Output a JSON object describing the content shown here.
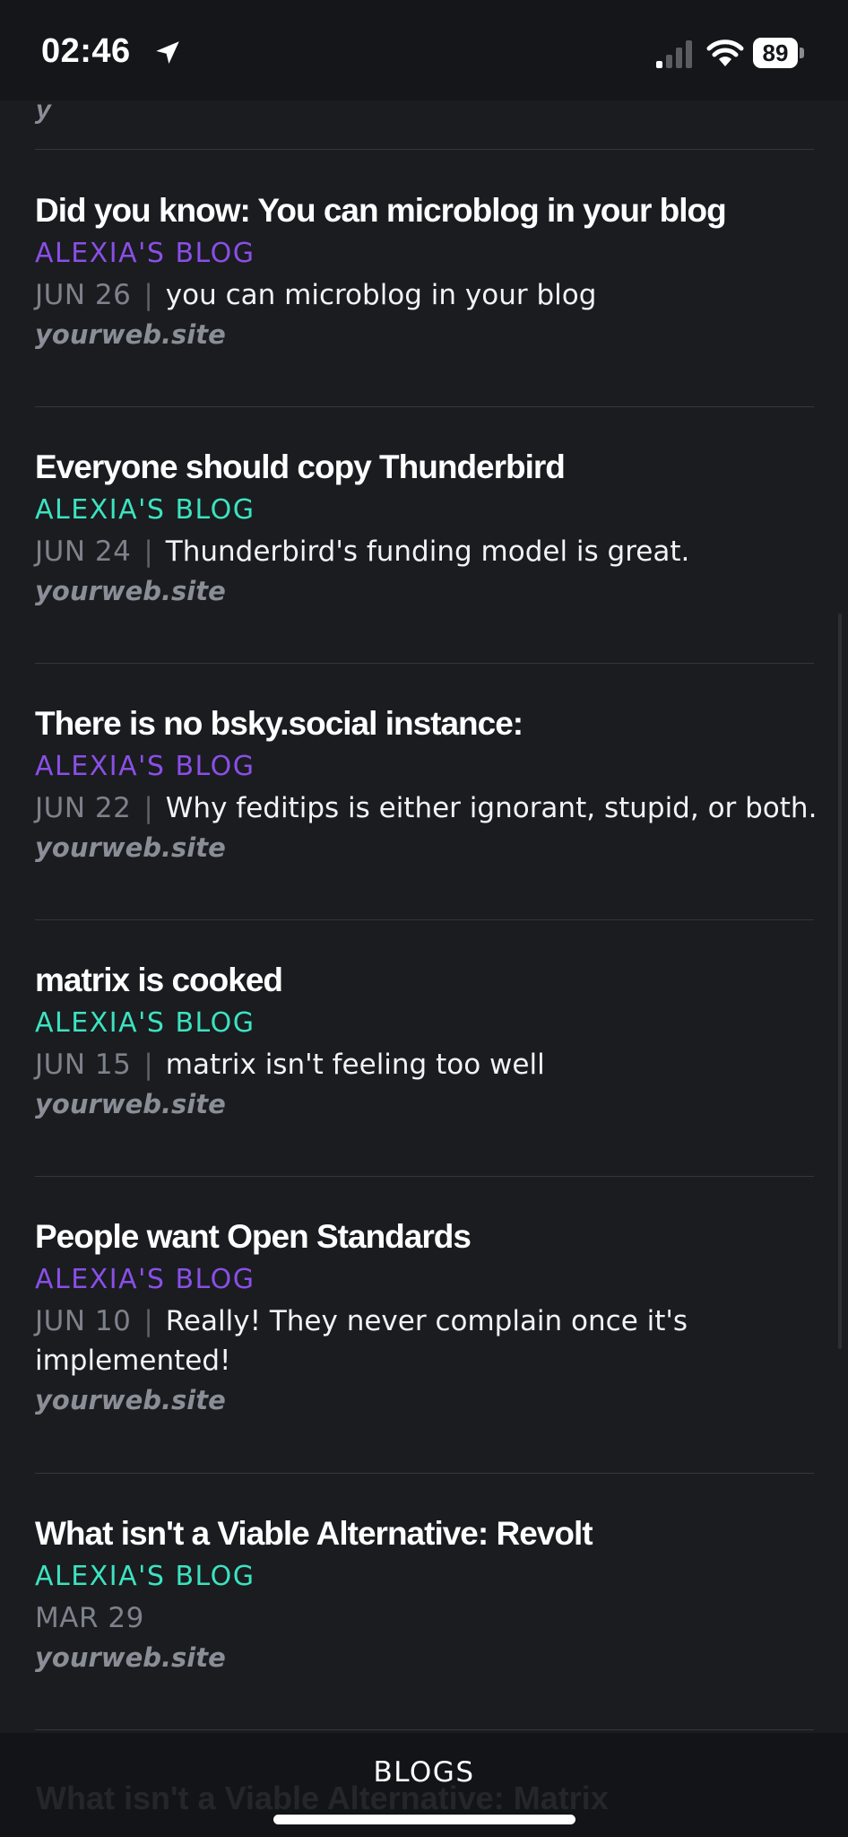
{
  "status_bar": {
    "time": "02:46",
    "battery": "89",
    "icons": [
      "location-arrow-icon",
      "cellular-signal-icon",
      "wifi-icon",
      "battery-icon"
    ]
  },
  "feed": {
    "top_cut_text": "y",
    "posts": [
      {
        "title": "Did you know: You can microblog in your blog",
        "blog": "ALEXIA'S BLOG",
        "blog_color": "#8a4fe6",
        "date": "JUN 26",
        "separator": "|",
        "summary": "you can microblog in your blog",
        "site": "yourweb.site"
      },
      {
        "title": "Everyone should copy Thunderbird",
        "blog": "ALEXIA'S BLOG",
        "blog_color": "#3ce3c0",
        "date": "JUN 24",
        "separator": "|",
        "summary": "Thunderbird's funding model is great.",
        "site": "yourweb.site"
      },
      {
        "title": "There is no bsky.social instance:",
        "blog": "ALEXIA'S BLOG",
        "blog_color": "#8a4fe6",
        "date": "JUN 22",
        "separator": "|",
        "summary": "Why feditips is either ignorant, stupid, or both.",
        "site": "yourweb.site"
      },
      {
        "title": "matrix is cooked",
        "blog": "ALEXIA'S BLOG",
        "blog_color": "#3ce3c0",
        "date": "JUN 15",
        "separator": "|",
        "summary": "matrix isn't feeling too well",
        "site": "yourweb.site"
      },
      {
        "title": "People want Open Standards",
        "blog": "ALEXIA'S BLOG",
        "blog_color": "#8a4fe6",
        "date": "JUN 10",
        "separator": "|",
        "summary": "Really! They never complain once it's implemented!",
        "site": "yourweb.site"
      },
      {
        "title": "What isn't a Viable Alternative: Revolt",
        "blog": "ALEXIA'S BLOG",
        "blog_color": "#3ce3c0",
        "date": "MAR 29",
        "separator": "",
        "summary": "",
        "site": "yourweb.site"
      }
    ]
  },
  "bottom_bar": {
    "tab_label": "BLOGS",
    "ghost_text": "What isn't a Viable Alternative: Matrix"
  }
}
